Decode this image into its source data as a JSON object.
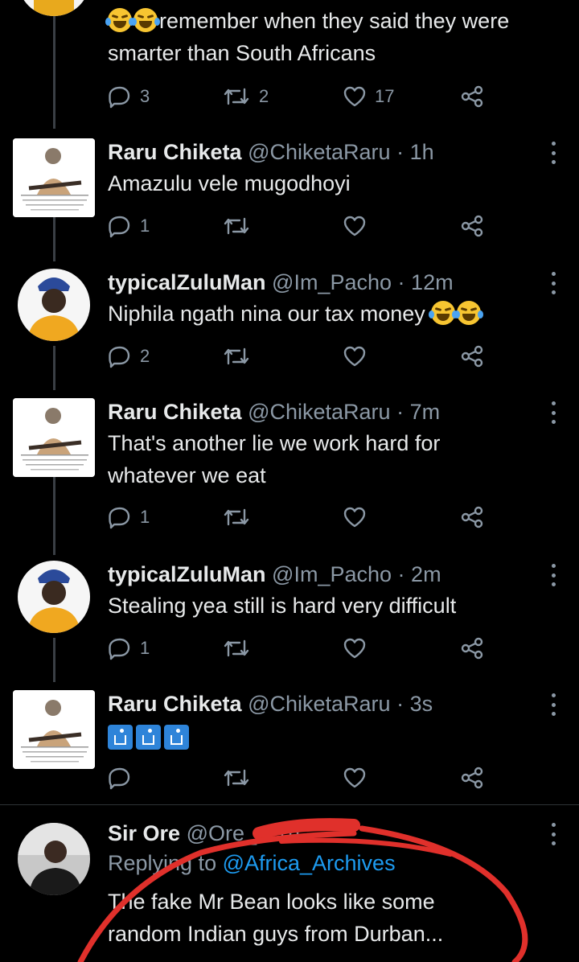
{
  "colors": {
    "background": "#000000",
    "text": "#e7e9ea",
    "muted": "#8b98a5",
    "link": "#1d9bf0",
    "scribble": "#e0302b"
  },
  "tweets": [
    {
      "text_lines": [
        "remember when they said they were",
        "smarter than South Africans"
      ],
      "reply_count": "3",
      "retweet_count": "2",
      "like_count": "17"
    },
    {
      "name": "Raru Chiketa",
      "handle": "@ChiketaRaru",
      "dot": "·",
      "time": "1h",
      "text_lines": [
        "Amazulu vele mugodhoyi"
      ],
      "reply_count": "1",
      "retweet_count": "",
      "like_count": ""
    },
    {
      "name": "typicalZuluMan",
      "handle": "@Im_Pacho",
      "dot": "·",
      "time": "12m",
      "text_lines": [
        "Niphila ngath nina our tax money"
      ],
      "reply_count": "2",
      "retweet_count": "",
      "like_count": ""
    },
    {
      "name": "Raru Chiketa",
      "handle": "@ChiketaRaru",
      "dot": "·",
      "time": "7m",
      "text_lines": [
        "That's another lie we work hard for",
        "whatever we eat"
      ],
      "reply_count": "1",
      "retweet_count": "",
      "like_count": ""
    },
    {
      "name": "typicalZuluMan",
      "handle": "@Im_Pacho",
      "dot": "·",
      "time": "2m",
      "text_lines": [
        "Stealing yea still is hard very difficult"
      ],
      "reply_count": "1",
      "retweet_count": "",
      "like_count": ""
    },
    {
      "name": "Raru Chiketa",
      "handle": "@ChiketaRaru",
      "dot": "·",
      "time": "3s",
      "text_lines": [
        ""
      ],
      "reply_count": "",
      "retweet_count": "",
      "like_count": ""
    },
    {
      "name": "Sir Ore",
      "handle": "@Ore_",
      "dot": "·",
      "time": "1h",
      "replying_prefix": "Replying to ",
      "replying_to": "@Africa_Archives",
      "text_lines": [
        "The fake Mr Bean looks like some",
        "random Indian guys from Durban..."
      ]
    }
  ],
  "icons": {
    "reply": "reply-icon",
    "retweet": "retweet-icon",
    "like": "heart-icon",
    "share": "share-icon",
    "more": "more-options-icon",
    "emoji": "face-with-tears-of-joy-emoji",
    "wc": "put-litter-in-its-place-emoji"
  }
}
